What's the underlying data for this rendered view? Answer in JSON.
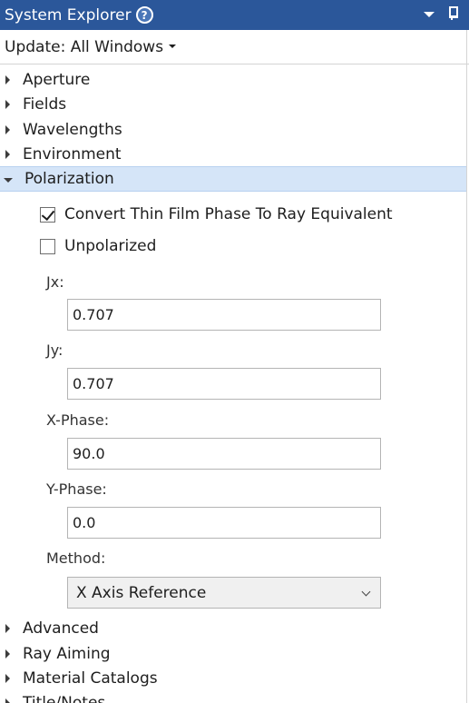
{
  "header": {
    "title": "System Explorer",
    "help_icon": "?",
    "dropdown_icon": "dropdown-arrow-icon",
    "pin_icon": "pin-icon"
  },
  "toolbar": {
    "update_label": "Update: All Windows"
  },
  "tree_top": [
    {
      "label": "Aperture",
      "expanded": false
    },
    {
      "label": "Fields",
      "expanded": false
    },
    {
      "label": "Wavelengths",
      "expanded": false
    },
    {
      "label": "Environment",
      "expanded": false
    },
    {
      "label": "Polarization",
      "expanded": true,
      "selected": true
    }
  ],
  "polarization": {
    "convert_thin_film": {
      "label": "Convert Thin Film Phase To Ray Equivalent",
      "checked": true
    },
    "unpolarized": {
      "label": "Unpolarized",
      "checked": false
    },
    "jx": {
      "label": "Jx:",
      "value": "0.707"
    },
    "jy": {
      "label": "Jy:",
      "value": "0.707"
    },
    "x_phase": {
      "label": "X-Phase:",
      "value": "90.0"
    },
    "y_phase": {
      "label": "Y-Phase:",
      "value": "0.0"
    },
    "method": {
      "label": "Method:",
      "value": "X Axis Reference"
    }
  },
  "tree_bottom": [
    {
      "label": "Advanced",
      "expanded": false
    },
    {
      "label": "Ray Aiming",
      "expanded": false
    },
    {
      "label": "Material Catalogs",
      "expanded": false
    },
    {
      "label": "Title/Notes",
      "expanded": false
    }
  ],
  "colors": {
    "titlebar": "#2b579a",
    "selected_row": "#d5e5f8"
  }
}
